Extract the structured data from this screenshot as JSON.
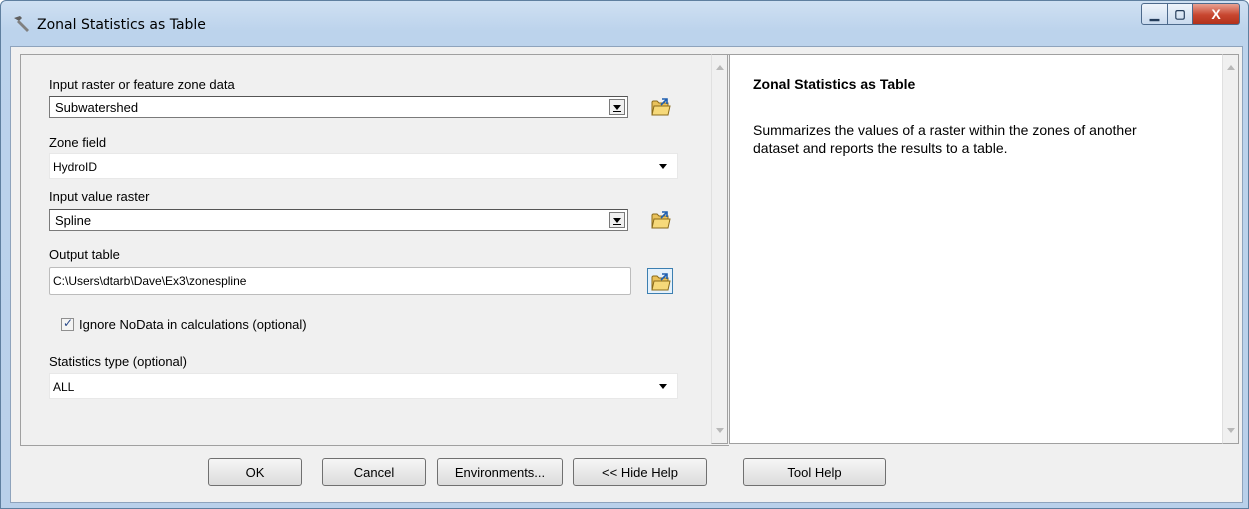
{
  "window": {
    "title": "Zonal Statistics as Table"
  },
  "window_controls": {
    "minimize_glyph": "▁",
    "maximize_glyph": "▢",
    "close_glyph": "X"
  },
  "form": {
    "input_zone": {
      "label": "Input raster or feature zone data",
      "value": "Subwatershed"
    },
    "zone_field": {
      "label": "Zone field",
      "value": "HydroID"
    },
    "input_value": {
      "label": "Input value raster",
      "value": "Spline"
    },
    "output_table": {
      "label": "Output table",
      "value": "C:\\Users\\dtarb\\Dave\\Ex3\\zonespline"
    },
    "ignore_nodata": {
      "label": "Ignore NoData in calculations (optional)",
      "checked": true
    },
    "stat_type": {
      "label": "Statistics type (optional)",
      "value": "ALL"
    }
  },
  "help": {
    "title": "Zonal Statistics as Table",
    "body": "Summarizes the values of a raster within the zones of another dataset and reports the results to a table."
  },
  "buttons": {
    "ok": "OK",
    "cancel": "Cancel",
    "environments": "Environments...",
    "hide_help": "<< Hide Help",
    "tool_help": "Tool Help"
  },
  "icons": {
    "title": "hammer-icon",
    "browse": "open-folder-icon"
  }
}
